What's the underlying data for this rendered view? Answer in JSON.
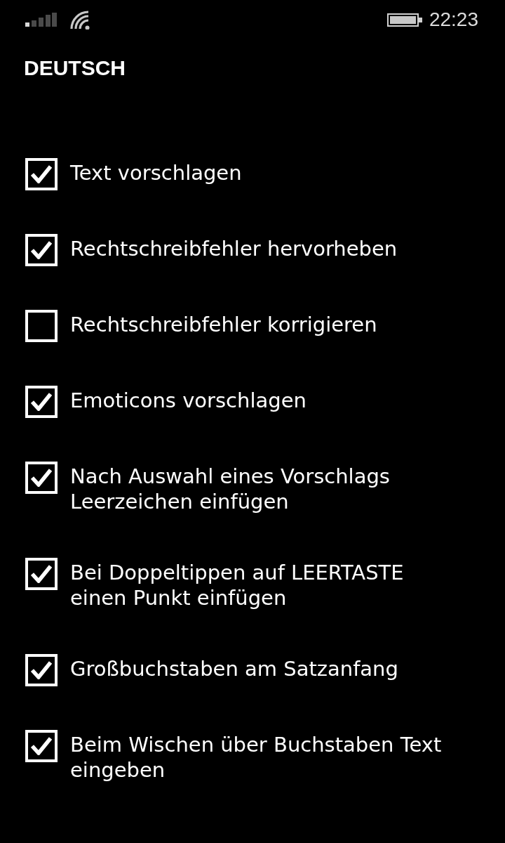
{
  "status_bar": {
    "time": "22:23"
  },
  "header": {
    "title": "DEUTSCH"
  },
  "options": [
    {
      "lines": [
        "Text vorschlagen"
      ],
      "checked": true
    },
    {
      "lines": [
        "Rechtschreibfehler hervorheben"
      ],
      "checked": true
    },
    {
      "lines": [
        "Rechtschreibfehler korrigieren"
      ],
      "checked": false
    },
    {
      "lines": [
        "Emoticons vorschlagen"
      ],
      "checked": true
    },
    {
      "lines": [
        "Nach Auswahl eines Vorschlags",
        "Leerzeichen einfügen"
      ],
      "checked": true
    },
    {
      "lines": [
        "Bei Doppeltippen auf LEERTASTE",
        "einen Punkt einfügen"
      ],
      "checked": true
    },
    {
      "lines": [
        "Großbuchstaben am Satzanfang"
      ],
      "checked": true
    },
    {
      "lines": [
        "Beim Wischen über Buchstaben Text",
        "eingeben"
      ],
      "checked": true
    }
  ]
}
